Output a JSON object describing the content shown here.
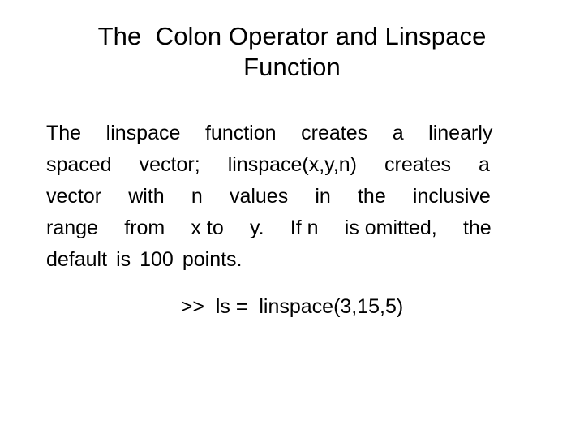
{
  "slide": {
    "background_color": "#ffffff",
    "text_color": "#000000",
    "title": {
      "line1": "The  Colon Operator and Linspace",
      "line2": "Function"
    },
    "body": {
      "full_text": "The linspace function creates a linearly spaced vector; linspace(x,y,n) creates a vector with n values in the inclusive range from x to y. If n is omitted, the default is 100 points.",
      "lines": [
        {
          "justified": true,
          "words": [
            "The",
            "linspace",
            "function",
            "creates",
            "a",
            "linearly"
          ]
        },
        {
          "justified": true,
          "words": [
            "spaced",
            "vector;",
            "linspace(x,y,n)",
            "creates",
            "a"
          ]
        },
        {
          "justified": true,
          "words": [
            "vector",
            "with",
            "n",
            "values",
            "in",
            "the",
            "inclusive"
          ]
        },
        {
          "justified": true,
          "words": [
            "range",
            "from",
            "x to",
            "y.",
            "If n",
            "is omitted,",
            "the"
          ]
        },
        {
          "justified": false,
          "words": [
            "default",
            "is",
            "100",
            "points."
          ]
        }
      ]
    },
    "code_example": {
      "prompt": ">>",
      "variable": "ls",
      "operator": "=",
      "call": "linspace(3,15,5)",
      "text": ">>  ls =  linspace(3,15,5)"
    }
  }
}
